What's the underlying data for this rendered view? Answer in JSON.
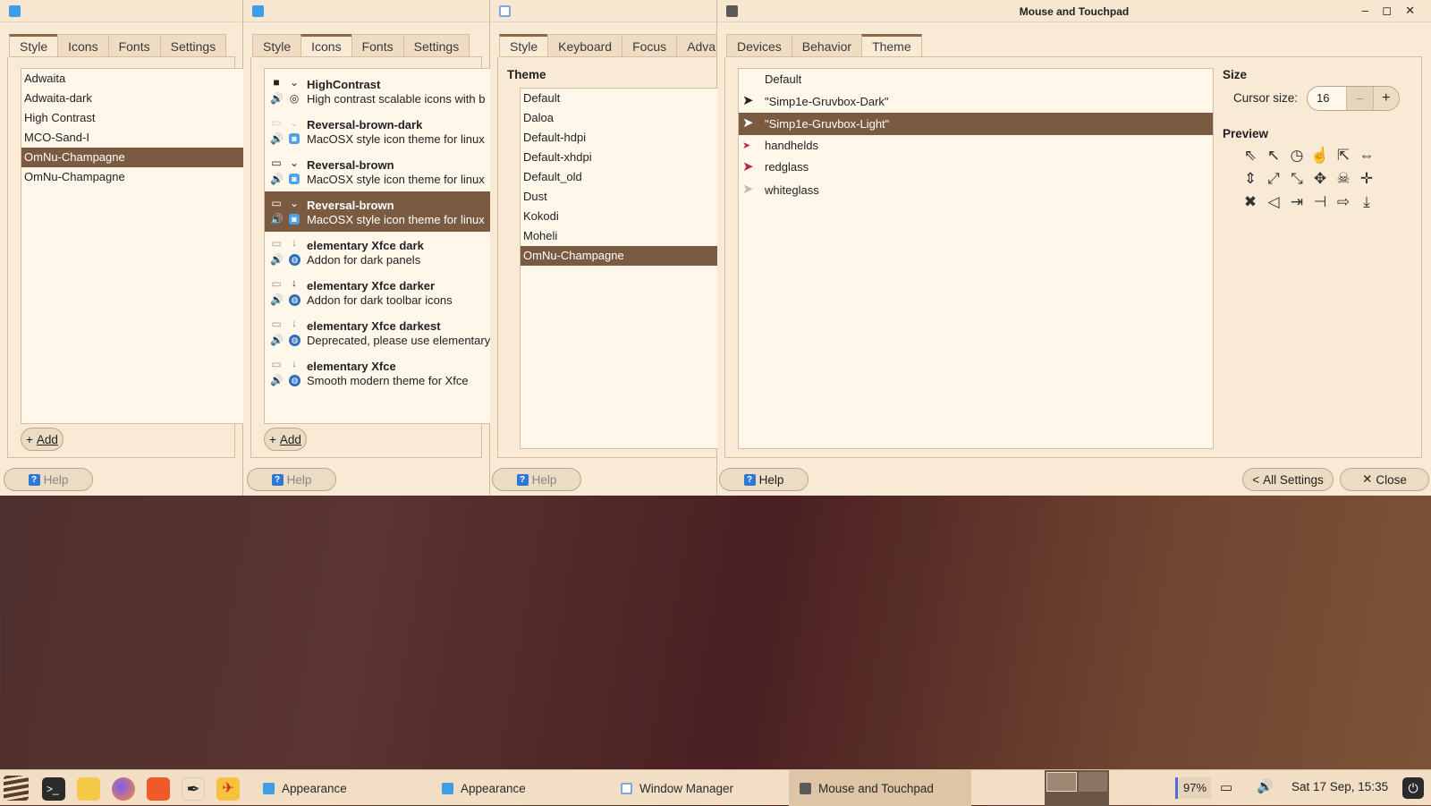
{
  "windows": [
    {
      "tabs": [
        "Style",
        "Icons",
        "Fonts",
        "Settings"
      ],
      "active_tab": 0,
      "items": [
        "Adwaita",
        "Adwaita-dark",
        "High Contrast",
        "MCO-Sand-I",
        "OmNu-Champagne",
        "OmNu-Champagne"
      ],
      "selected": 4,
      "add_label": "Add",
      "help_label": "Help"
    },
    {
      "tabs": [
        "Style",
        "Icons",
        "Fonts",
        "Settings"
      ],
      "active_tab": 1,
      "items": [
        {
          "name": "HighContrast",
          "desc": "High contrast scalable icons with b"
        },
        {
          "name": "Reversal-brown-dark",
          "desc": "MacOSX style icon theme for linux"
        },
        {
          "name": "Reversal-brown",
          "desc": "MacOSX style icon theme for linux"
        },
        {
          "name": "Reversal-brown",
          "desc": "MacOSX style icon theme for linux"
        },
        {
          "name": "elementary Xfce dark",
          "desc": "Addon for dark panels"
        },
        {
          "name": "elementary Xfce darker",
          "desc": "Addon for dark toolbar icons"
        },
        {
          "name": "elementary Xfce darkest",
          "desc": "Deprecated, please use elementary"
        },
        {
          "name": "elementary Xfce",
          "desc": "Smooth modern theme for Xfce"
        }
      ],
      "selected": 3,
      "add_label": "Add",
      "help_label": "Help"
    },
    {
      "tabs": [
        "Style",
        "Keyboard",
        "Focus",
        "Advanc"
      ],
      "active_tab": 0,
      "section": "Theme",
      "items": [
        "Default",
        "Daloa",
        "Default-hdpi",
        "Default-xhdpi",
        "Default_old",
        "Dust",
        "Kokodi",
        "Moheli",
        "OmNu-Champagne"
      ],
      "selected": 8,
      "help_label": "Help"
    },
    {
      "title": "Mouse and Touchpad",
      "tabs": [
        "Devices",
        "Behavior",
        "Theme"
      ],
      "active_tab": 2,
      "cursors": [
        "Default",
        "\"Simp1e-Gruvbox-Dark\"",
        "\"Simp1e-Gruvbox-Light\"",
        "handhelds",
        "redglass",
        "whiteglass"
      ],
      "selected": 2,
      "size_heading": "Size",
      "cursor_size_label": "Cursor size:",
      "cursor_size_value": "16",
      "preview_heading": "Preview",
      "help_label": "Help",
      "all_settings_label": "All Settings",
      "close_label": "Close"
    }
  ],
  "taskbar": {
    "tasks": [
      "Appearance",
      "Appearance",
      "Window Manager",
      "Mouse and Touchpad"
    ],
    "battery": "97%",
    "clock": "Sat 17 Sep, 15:35"
  },
  "colors": {
    "accent": "#7a5a40",
    "window_bg": "#f9ead6"
  }
}
